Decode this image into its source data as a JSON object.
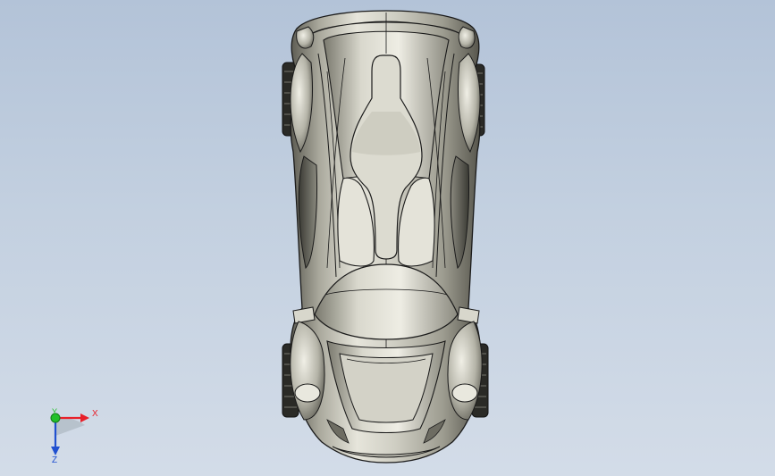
{
  "viewport": {
    "background_top": "#b3c3d8",
    "background_bottom": "#d3dce8",
    "model_color": "#c9c8bd",
    "edge_color": "#1a1a1a"
  },
  "triad": {
    "x_label": "X",
    "y_label": "Y",
    "z_label": "Z",
    "x_color": "#e8202a",
    "y_color": "#22c02a",
    "z_color": "#2050d0"
  }
}
